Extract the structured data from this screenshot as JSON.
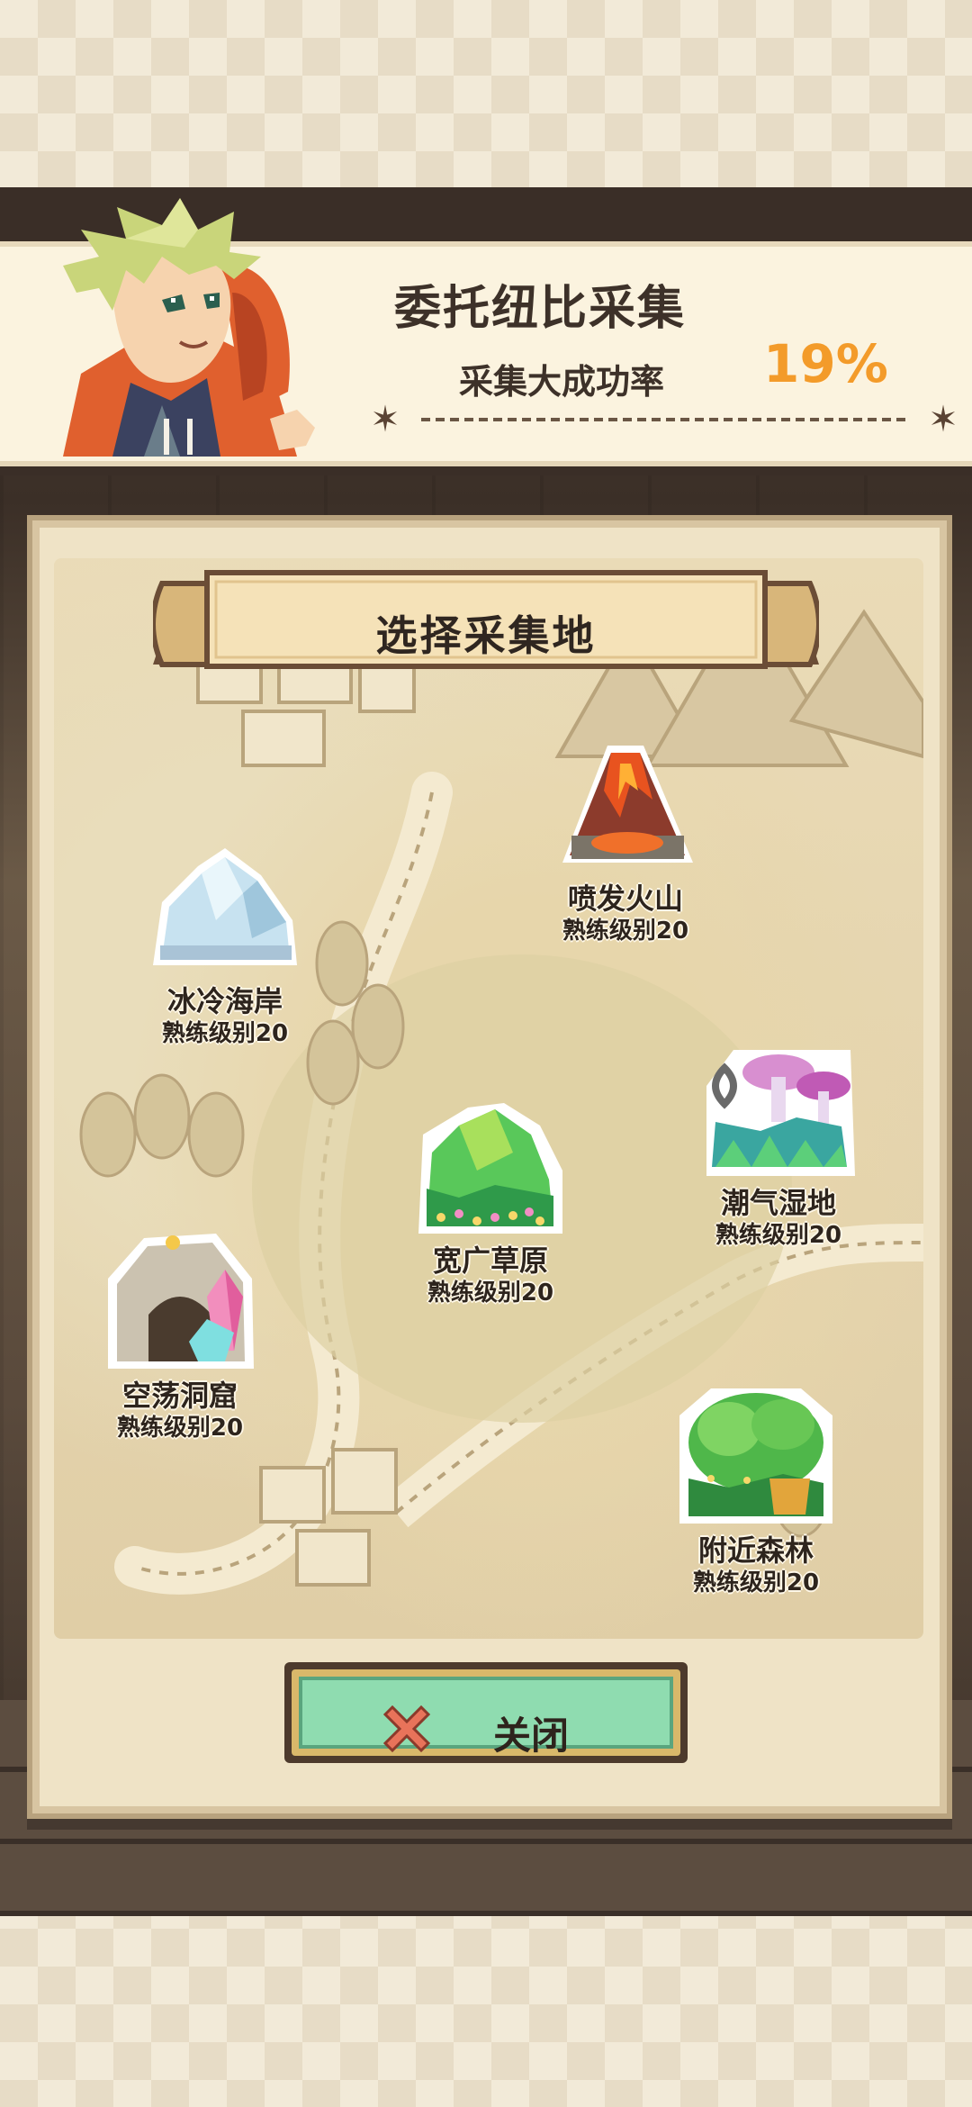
{
  "header": {
    "title": "委托纽比采集",
    "rate_label": "采集大成功率",
    "rate_value": "19%"
  },
  "panel": {
    "title": "选择采集地"
  },
  "sites": [
    {
      "id": "volcano",
      "name": "喷发火山",
      "level": "熟练级别20",
      "icon": "volcano-icon"
    },
    {
      "id": "coast",
      "name": "冰冷海岸",
      "level": "熟练级别20",
      "icon": "iceberg-icon"
    },
    {
      "id": "wetland",
      "name": "潮气湿地",
      "level": "熟练级别20",
      "icon": "mushroom-swamp-icon"
    },
    {
      "id": "grassland",
      "name": "宽广草原",
      "level": "熟练级别20",
      "icon": "grass-hill-icon"
    },
    {
      "id": "cave",
      "name": "空荡洞窟",
      "level": "熟练级别20",
      "icon": "crystal-cave-icon"
    },
    {
      "id": "forest",
      "name": "附近森林",
      "level": "熟练级别20",
      "icon": "forest-icon"
    }
  ],
  "close_button": {
    "label": "关闭",
    "icon": "close-icon"
  },
  "colors": {
    "accent": "#f39b2a",
    "button_face": "#8fdcb0",
    "dark_frame": "#3a2e27"
  }
}
